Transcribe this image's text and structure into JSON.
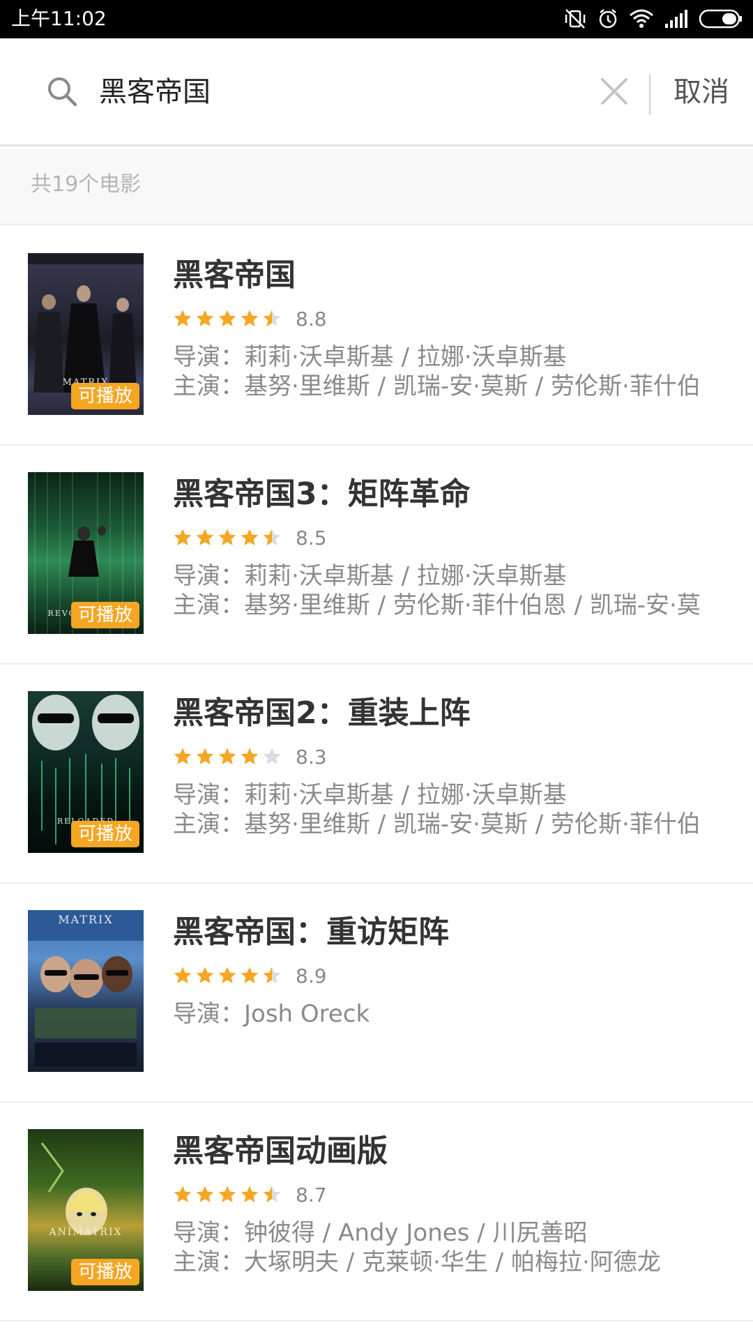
{
  "status_bar": {
    "time": "上午11:02",
    "icons": [
      "vibrate-off-icon",
      "alarm-icon",
      "wifi-icon",
      "signal-icon",
      "battery-icon"
    ]
  },
  "search": {
    "query": "黑客帝国",
    "cancel_label": "取消"
  },
  "results": {
    "count_text": "共19个电影"
  },
  "colors": {
    "star": "#f5a623",
    "badge": "#f5a623",
    "star_empty": "#dcdcdc"
  },
  "movies": [
    {
      "title": "黑客帝国",
      "score": "8.8",
      "stars": 4.5,
      "director": "导演：莉莉·沃卓斯基 / 拉娜·沃卓斯基",
      "cast": "主演：基努·里维斯 / 凯瑞-安·莫斯 / 劳伦斯·菲什伯",
      "badge": "可播放",
      "poster_text": "MATRIX"
    },
    {
      "title": "黑客帝国3：矩阵革命",
      "score": "8.5",
      "stars": 4.5,
      "director": "导演：莉莉·沃卓斯基 / 拉娜·沃卓斯基",
      "cast": "主演：基努·里维斯 / 劳伦斯·菲什伯恩 / 凯瑞-安·莫",
      "badge": "可播放",
      "poster_text": "REVOLUTIONS"
    },
    {
      "title": "黑客帝国2：重装上阵",
      "score": "8.3",
      "stars": 4,
      "director": "导演：莉莉·沃卓斯基 / 拉娜·沃卓斯基",
      "cast": "主演：基努·里维斯 / 凯瑞-安·莫斯 / 劳伦斯·菲什伯",
      "badge": "可播放",
      "poster_text": "RELOADED"
    },
    {
      "title": "黑客帝国：重访矩阵",
      "score": "8.9",
      "stars": 4.5,
      "director": "导演：Josh Oreck",
      "cast": "",
      "badge": "",
      "poster_text": "MATRIX"
    },
    {
      "title": "黑客帝国动画版",
      "score": "8.7",
      "stars": 4.5,
      "director": "导演：钟彼得 / Andy Jones / 川尻善昭",
      "cast": "主演：大塚明夫 / 克莱顿·华生 / 帕梅拉·阿德龙",
      "badge": "可播放",
      "poster_text": "ANIMATRIX"
    }
  ]
}
